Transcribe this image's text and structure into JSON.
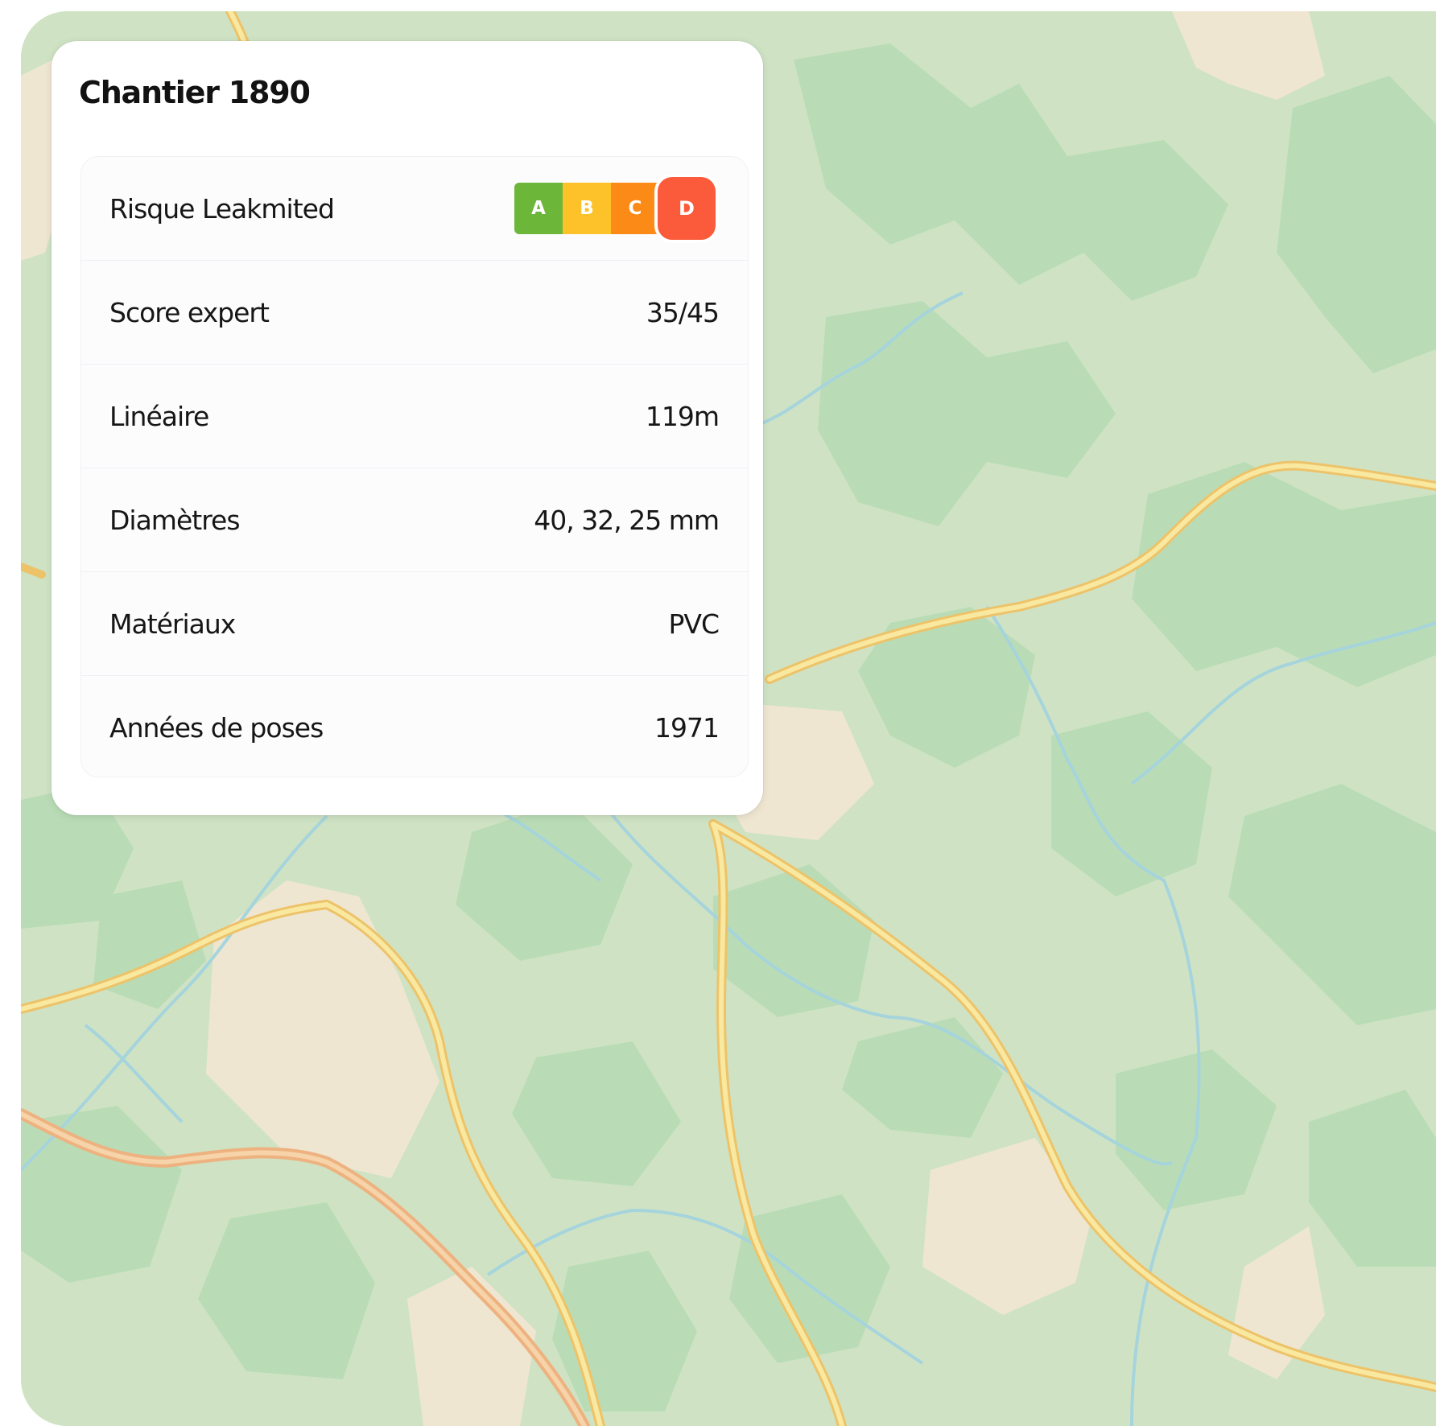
{
  "card": {
    "title": "Chantier 1890",
    "rows": [
      {
        "label": "Risque Leakmited",
        "type": "rating"
      },
      {
        "label": "Score expert",
        "value": "35/45"
      },
      {
        "label": "Linéaire",
        "value": "119m"
      },
      {
        "label": "Diamètres",
        "value": "40, 32, 25 mm"
      },
      {
        "label": "Matériaux",
        "value": "PVC"
      },
      {
        "label": "Années de poses",
        "value": "1971"
      }
    ]
  },
  "rating": {
    "grades": [
      {
        "letter": "A",
        "color": "#6cb73a"
      },
      {
        "letter": "B",
        "color": "#fdc22a"
      },
      {
        "letter": "C",
        "color": "#fb8a17"
      },
      {
        "letter": "D",
        "color": "#fb5b3b"
      }
    ],
    "selected": "D"
  },
  "map": {
    "colors": {
      "base": "#cfe3c4",
      "forest": "#b9dcb6",
      "open_land": "#efe6d2",
      "water": "#a6d4dc",
      "road_fill": "#f8e8a0",
      "road_edge": "#edc36a",
      "major_road": "#f0b48a"
    }
  }
}
